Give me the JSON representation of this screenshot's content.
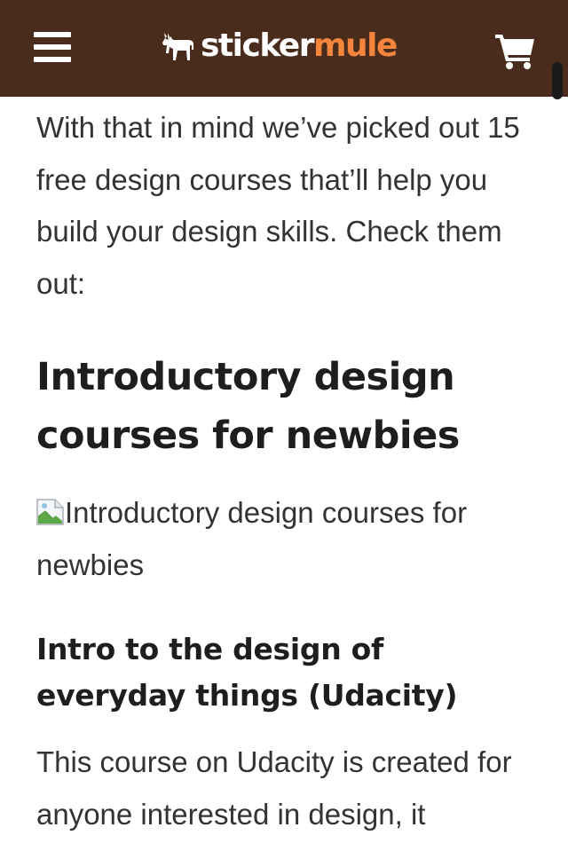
{
  "header": {
    "logo_sticker": "sticker",
    "logo_mule": "mule",
    "logo_icon": "mule-icon",
    "menu_icon": "hamburger-menu-icon",
    "cart_icon": "shopping-cart-icon",
    "brand_color": "#4a2c1d",
    "accent_color": "#f5843c"
  },
  "article": {
    "intro_paragraph": "With that in mind we’ve picked out 15 free design courses that’ll help you build your design skills. Check them out:",
    "section_heading": "Introductory design courses for newbies",
    "image_alt": "Introductory design courses for newbies",
    "course_heading": "Intro to the design of everyday things (Udacity)",
    "course_paragraph": "This course on Udacity is created for anyone interested in design, it"
  }
}
